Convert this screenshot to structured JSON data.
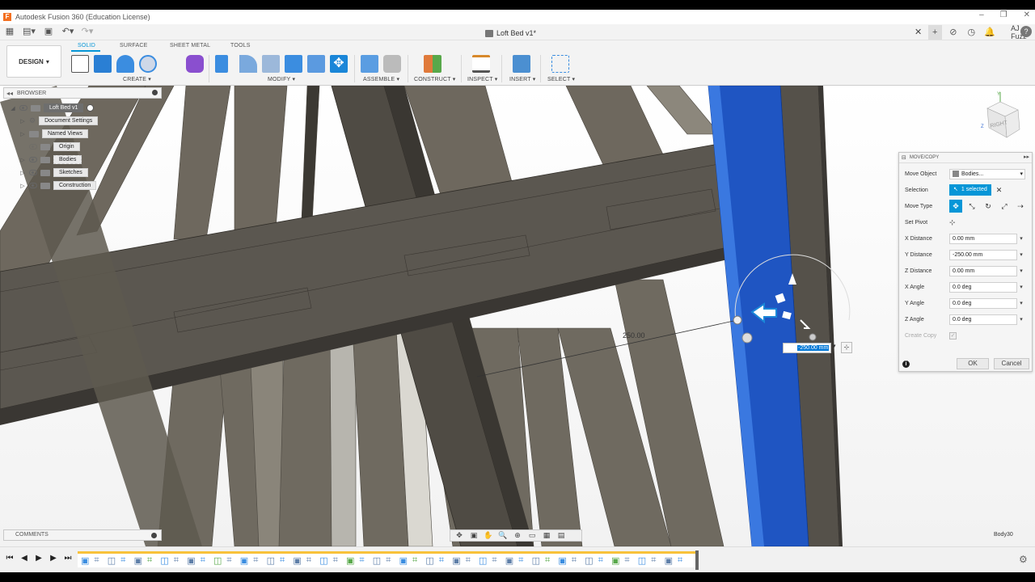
{
  "window": {
    "title": "Autodesk Fusion 360 (Education License)"
  },
  "document": {
    "name": "Loft Bed v1*"
  },
  "user": {
    "name": "AJ Fuzz"
  },
  "workspace": {
    "label": "DESIGN"
  },
  "ribbon": {
    "tabs": [
      "SOLID",
      "SURFACE",
      "SHEET METAL",
      "TOOLS"
    ],
    "active_tab": "SOLID",
    "groups": [
      "CREATE",
      "MODIFY",
      "ASSEMBLE",
      "CONSTRUCT",
      "INSPECT",
      "INSERT",
      "SELECT"
    ]
  },
  "browser": {
    "title": "BROWSER",
    "root": "Loft Bed v1",
    "items": [
      "Document Settings",
      "Named Views",
      "Origin",
      "Bodies",
      "Sketches",
      "Construction"
    ]
  },
  "viewcube": {
    "face": "RIGHT"
  },
  "move_copy": {
    "title": "MOVE/COPY",
    "move_object_label": "Move Object",
    "move_object_value": "Bodies...",
    "selection_label": "Selection",
    "selection_value": "1 selected",
    "move_type_label": "Move Type",
    "set_pivot_label": "Set Pivot",
    "x_distance_label": "X Distance",
    "x_distance_value": "0.00 mm",
    "y_distance_label": "Y Distance",
    "y_distance_value": "-250.00 mm",
    "z_distance_label": "Z Distance",
    "z_distance_value": "0.00 mm",
    "x_angle_label": "X Angle",
    "x_angle_value": "0.0 deg",
    "y_angle_label": "Y Angle",
    "y_angle_value": "0.0 deg",
    "z_angle_label": "Z Angle",
    "z_angle_value": "0.0 deg",
    "create_copy_label": "Create Copy",
    "ok_label": "OK",
    "cancel_label": "Cancel"
  },
  "canvas": {
    "dimension_text": "250.00",
    "input_value": "-250.00 mm",
    "body_label": "Body30"
  },
  "comments": {
    "title": "COMMENTS"
  },
  "colors": {
    "accent": "#0696d7",
    "selected_body": "#1f55c2",
    "timeline_bar": "#f8c23a"
  }
}
